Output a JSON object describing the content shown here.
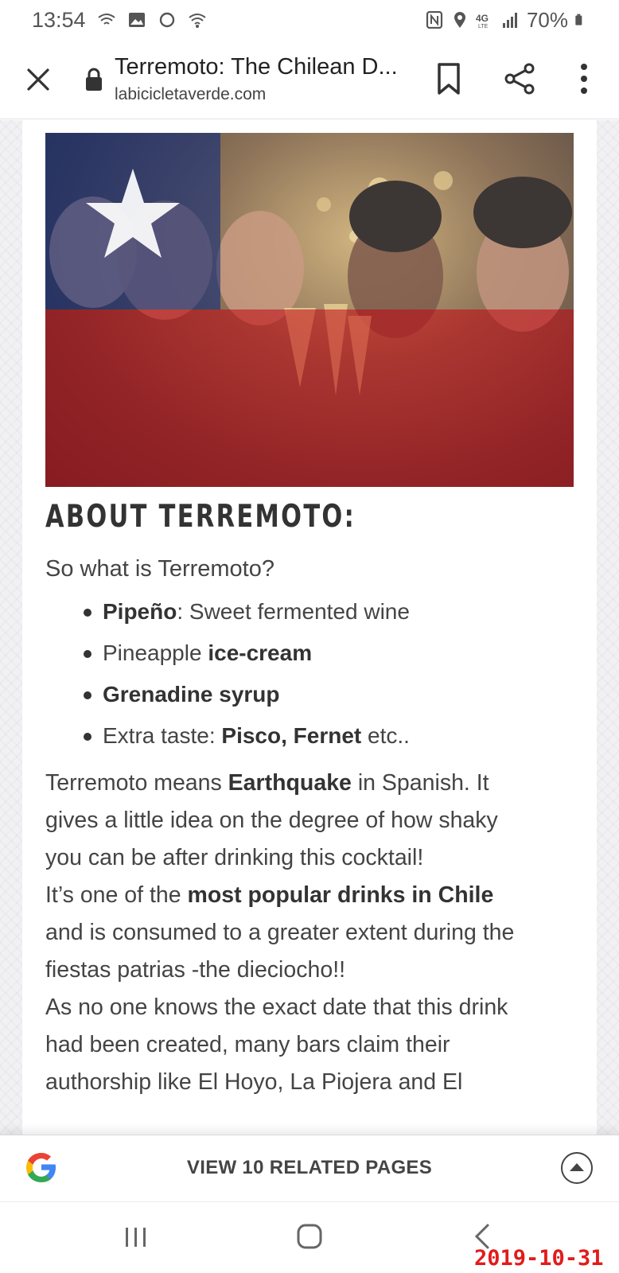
{
  "status_bar": {
    "time": "13:54",
    "battery": "70%",
    "icons_left": [
      "wifi-calling-icon",
      "gallery-icon",
      "sync-icon",
      "wifi-icon"
    ],
    "icons_right": [
      "nfc-icon",
      "location-icon",
      "4g-lte-icon",
      "signal-icon",
      "battery-icon"
    ]
  },
  "toolbar": {
    "title": "Terremoto: The Chilean D...",
    "url": "labicicletaverde.com"
  },
  "article": {
    "heading": "ABOUT TERREMOTO:",
    "lead": "So what is Terremoto?",
    "ingredients": [
      {
        "bold": "Pipeño",
        "text": ": Sweet fermented wine"
      },
      {
        "pre": "Pineapple ",
        "bold": "ice-cream"
      },
      {
        "bold": "Grenadine syrup"
      },
      {
        "pre": "Extra taste: ",
        "bold": "Pisco, Fernet",
        "text": " etc.."
      }
    ],
    "para1": {
      "line1_pre": "Terremoto means ",
      "line1_bold": "Earthquake",
      "line1_post": " in Spanish. It",
      "line2": "gives a little idea on the degree of how shaky",
      "line3": "you can be after drinking this cocktail!"
    },
    "para2": {
      "line1_pre": "It’s one of the ",
      "line1_bold": "most popular drinks in Chile",
      "line2": "and is consumed to a greater extent during the",
      "line3": "fiestas patrias -the dieciocho!!"
    },
    "para3": {
      "line1": "As no one knows the exact date that this drink",
      "line2": "had been created,  many bars claim their",
      "line3": "authorship like El Hoyo, La Piojera and El"
    }
  },
  "related_bar": {
    "label": "VIEW 10 RELATED PAGES"
  },
  "date_stamp": "2019-10-31",
  "colors": {
    "flag_blue": "#1f3b8a",
    "flag_red": "#c8202a",
    "date_stamp": "#e21b1b"
  }
}
